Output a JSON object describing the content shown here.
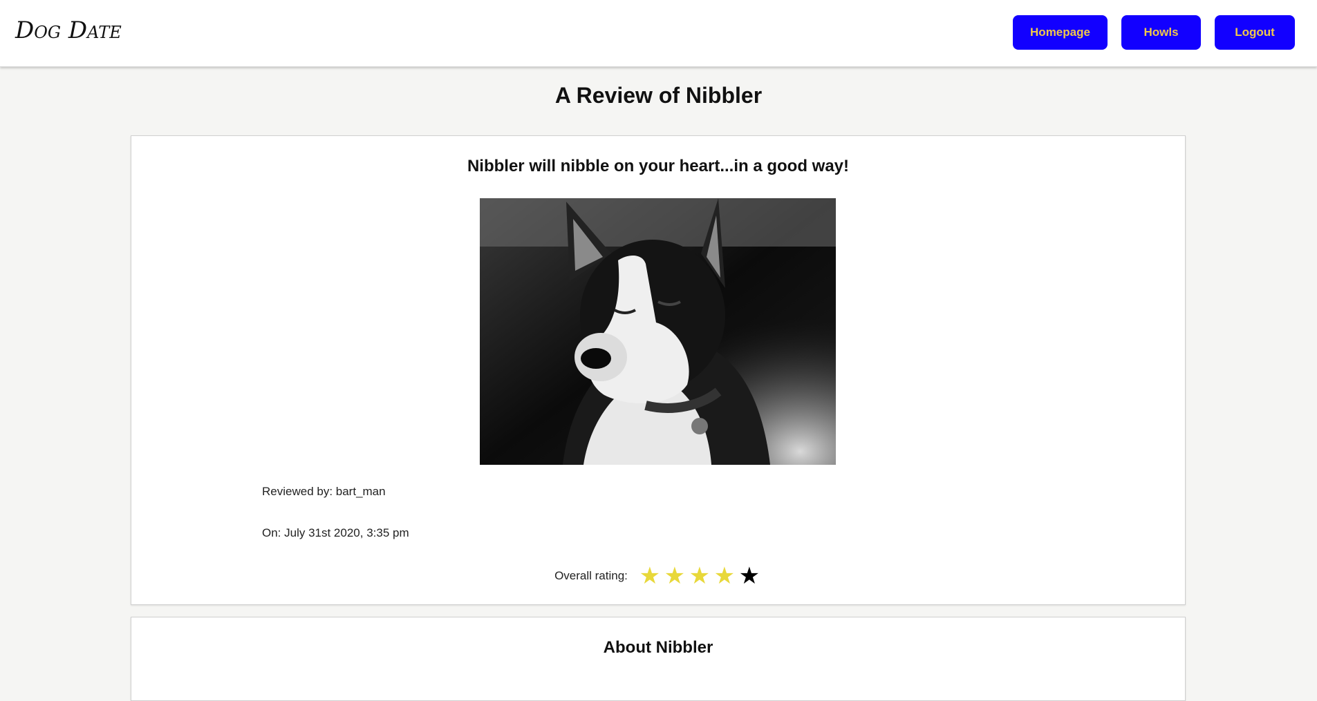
{
  "nav": {
    "logo": "Dog Date",
    "buttons": {
      "homepage": "Homepage",
      "howls": "Howls",
      "logout": "Logout"
    }
  },
  "page": {
    "title": "A Review of Nibbler"
  },
  "review": {
    "headline": "Nibbler will nibble on your heart...in a good way!",
    "reviewed_by": "Reviewed by: bart_man",
    "date": "On: July 31st 2020, 3:35 pm",
    "rating_label": "Overall rating:",
    "rating": 4,
    "rating_max": 5
  },
  "about": {
    "title": "About Nibbler"
  },
  "colors": {
    "button_bg": "#1200ff",
    "button_text": "#f1c94a",
    "star_filled": "#e8d83a",
    "star_empty": "#000000",
    "page_bg": "#f5f5f3"
  }
}
